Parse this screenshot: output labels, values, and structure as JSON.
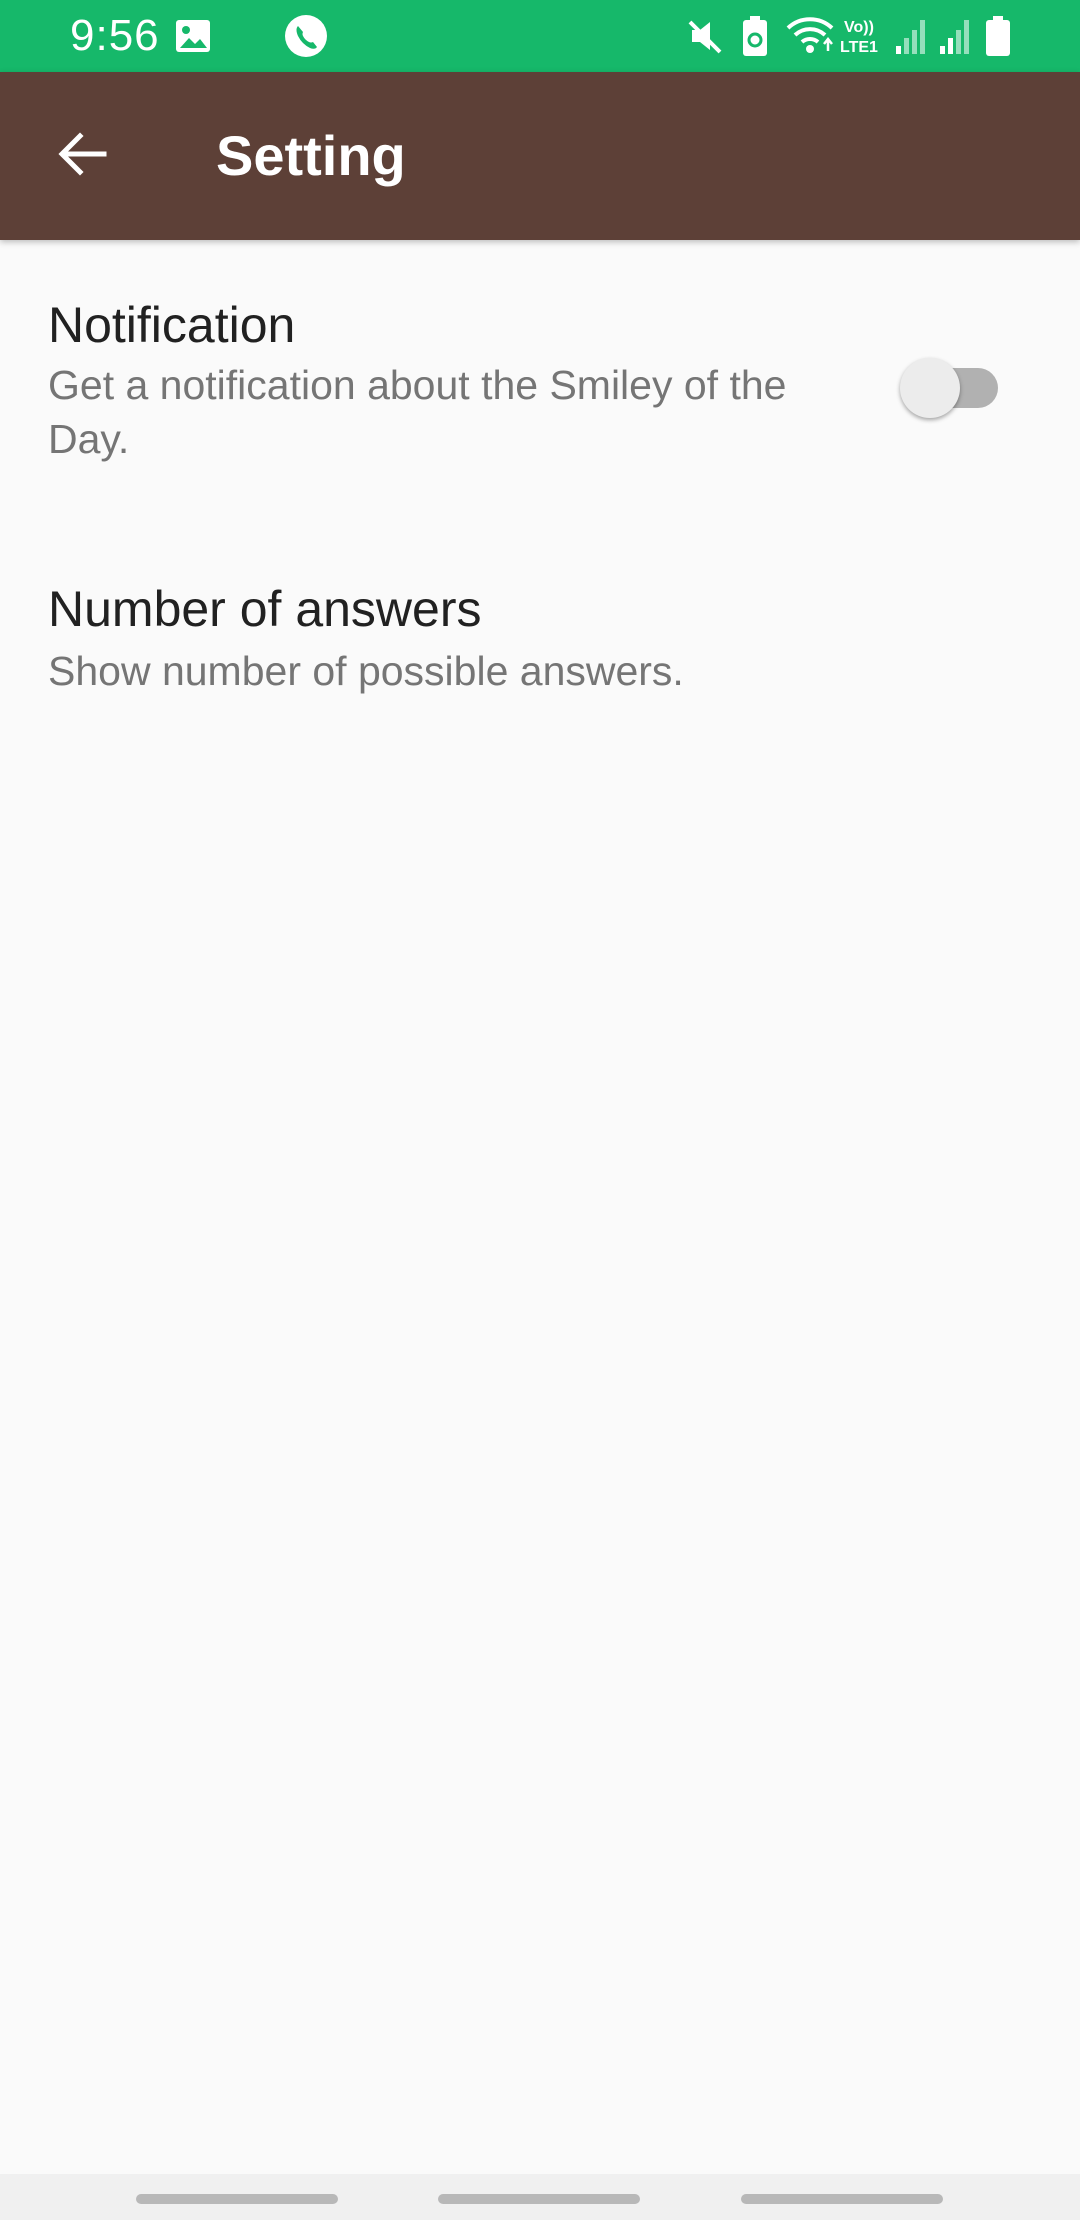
{
  "status_bar": {
    "time": "9:56",
    "color": "#16b86a",
    "icons": [
      "image-icon",
      "phone-icon",
      "mute-icon",
      "battery-saver-icon",
      "wifi-icon",
      "volte-icon",
      "signal-icon",
      "signal-icon",
      "battery-icon"
    ],
    "volte_label": "Vo)) LTE1"
  },
  "app_bar": {
    "title": "Setting",
    "back_icon": "arrow-back-icon",
    "color": "#5d4037"
  },
  "settings": {
    "notification": {
      "title": "Notification",
      "summary": "Get a notification about the Smiley of the Day.",
      "enabled": false
    },
    "answers": {
      "title": "Number of answers",
      "summary": "Show number of possible answers."
    }
  }
}
